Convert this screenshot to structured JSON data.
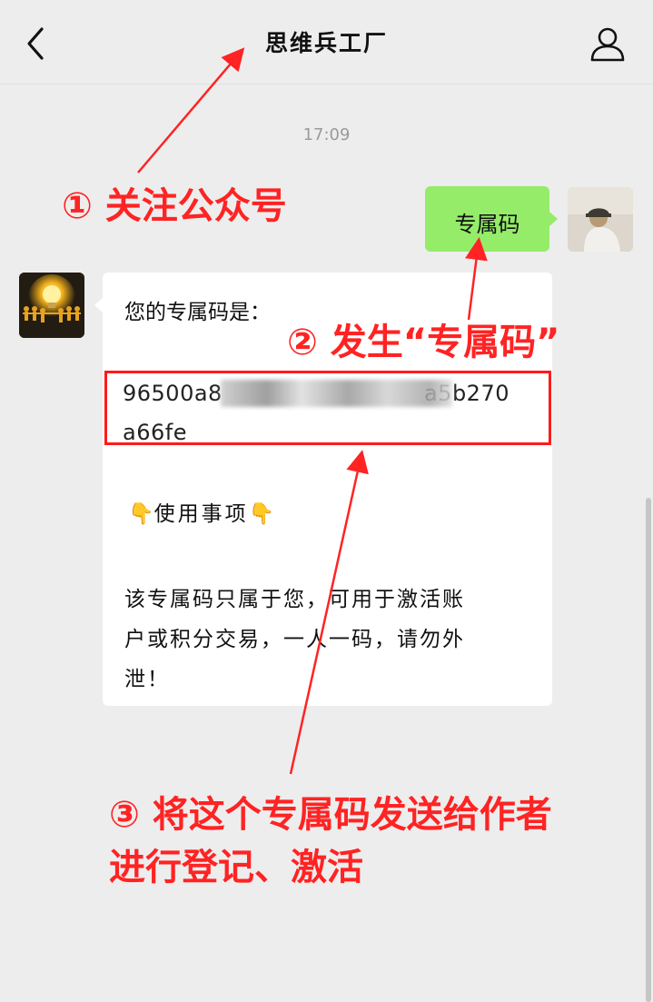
{
  "header": {
    "title": "思维兵工厂",
    "back_icon": "chevron-left-icon",
    "profile_icon": "person-icon"
  },
  "chat": {
    "timestamp": "17:09",
    "sent_message": "专属码",
    "reply": {
      "intro": "您的专属码是：",
      "code_line1": "96500a8",
      "code_line1_end": "a5b270",
      "code_line2": "a66fe",
      "notice_title": "使用事项",
      "body_line1": "该专属码只属于您，可用于激活账",
      "body_line2": "户或积分交易，一人一码，请勿外",
      "body_line3": "泄！"
    }
  },
  "annotations": {
    "step1": "① 关注公众号",
    "step2": "② 发生“专属码”",
    "step3_line1": "③ 将这个专属码发送给作者",
    "step3_line2": "进行登记、激活"
  },
  "colors": {
    "background": "#ededed",
    "sent_bubble": "#95ec69",
    "received_bubble": "#ffffff",
    "annotation_red": "#ff2323"
  }
}
